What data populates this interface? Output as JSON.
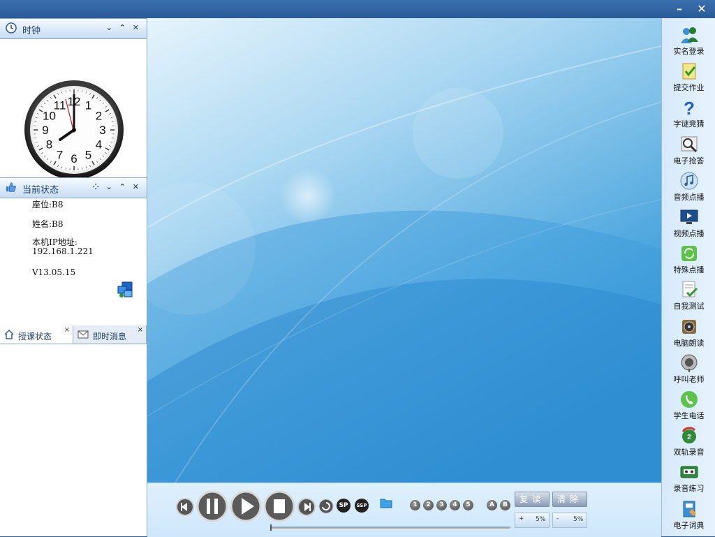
{
  "window": {
    "minimize_label": "–",
    "close_label": "✕"
  },
  "clock_panel": {
    "title": "时钟",
    "controls": "⌄ ⌃ ✕"
  },
  "status_panel": {
    "title": "当前状态",
    "controls": "⁘ ⌄ ⌃ ✕",
    "seat": "座位:B8",
    "name": "姓名:B8",
    "ip_label": "本机IP地址:",
    "ip_value": "192.168.1.221",
    "version": "V13.05.15"
  },
  "tabs": [
    {
      "label": "授课状态",
      "close": "×"
    },
    {
      "label": "即时消息",
      "close": "×"
    }
  ],
  "player": {
    "sp": "SP",
    "ssp": "SSP",
    "numbers": [
      "1",
      "2",
      "3",
      "4",
      "5"
    ],
    "ab": [
      "A",
      "B"
    ],
    "repeat_label": "复读",
    "clear_label": "清除",
    "speed_up": {
      "sign": "+",
      "value": "5%"
    },
    "speed_down": {
      "sign": "-",
      "value": "5%"
    },
    "progress": 0
  },
  "toolbar": [
    {
      "label": "实名登录",
      "icon": "users-icon"
    },
    {
      "label": "提交作业",
      "icon": "note-check-icon"
    },
    {
      "label": "字谜竞猜",
      "icon": "question-icon"
    },
    {
      "label": "电子抢答",
      "icon": "magnifier-icon"
    },
    {
      "label": "音频点播",
      "icon": "music-icon"
    },
    {
      "label": "视频点播",
      "icon": "monitor-icon"
    },
    {
      "label": "特殊点播",
      "icon": "refresh-icon"
    },
    {
      "label": "自我测试",
      "icon": "test-doc-icon"
    },
    {
      "label": "电脑朗读",
      "icon": "speaker-icon"
    },
    {
      "label": "呼叫老师",
      "icon": "microphone-icon"
    },
    {
      "label": "学生电话",
      "icon": "phone-icon"
    },
    {
      "label": "双轨录音",
      "icon": "dual-record-icon"
    },
    {
      "label": "录音练习",
      "icon": "tape-icon"
    },
    {
      "label": "电子词典",
      "icon": "dictionary-icon"
    }
  ],
  "colors": {
    "titlebar": "#2a5e9c",
    "panel_text": "#1f3e66",
    "accent": "#3a8fd8"
  }
}
